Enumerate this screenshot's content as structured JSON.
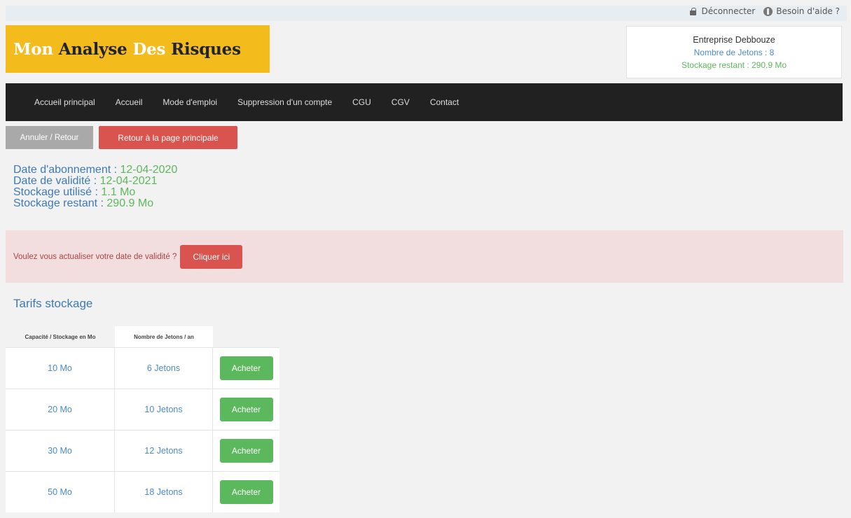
{
  "header": {
    "logout_label": "Déconnecter",
    "help_label": "Besoin d'aide ?",
    "logo_words": [
      "Mon",
      "Analyse",
      "Des",
      "Risques"
    ]
  },
  "account": {
    "company": "Entreprise Debbouze",
    "tokens": "Nombre de Jetons : 8",
    "storage": "Stockage restant : 290.9 Mo"
  },
  "nav": {
    "items": [
      "Accueil principal",
      "Accueil",
      "Mode d'emploi",
      "Suppression d'un compte",
      "CGU",
      "CGV",
      "Contact"
    ]
  },
  "actions": {
    "back_label": "Annuler / Retour",
    "home_label": "Retour à la page principale"
  },
  "subscription": {
    "start_label": "Date d'abonnement : ",
    "start_value": "12-04-2020",
    "validity_label": "Date de validité : ",
    "validity_value": "12-04-2021",
    "used_label": "Stockage utilisé : ",
    "used_value": "1.1 Mo",
    "remaining_label": "Stockage restant : ",
    "remaining_value": "290.9 Mo"
  },
  "alert": {
    "message": "Voulez vous actualiser votre date de validité ?",
    "button_label": "Cliquer ici"
  },
  "pricing": {
    "title": "Tarifs stockage",
    "headers": [
      "Capacité / Stockage en Mo",
      "Nombre de Jetons / an"
    ],
    "rows": [
      {
        "capacity": "10 Mo",
        "tokens": "6 Jetons",
        "action": "Acheter"
      },
      {
        "capacity": "20 Mo",
        "tokens": "10 Jetons",
        "action": "Acheter"
      },
      {
        "capacity": "30 Mo",
        "tokens": "12 Jetons",
        "action": "Acheter"
      },
      {
        "capacity": "50 Mo",
        "tokens": "18 Jetons",
        "action": "Acheter"
      }
    ]
  },
  "colors": {
    "logo_bg": "#f4bb1c",
    "navbar_bg": "#212121",
    "danger": "#d9534f",
    "success": "#5cb85c",
    "primary_text": "#3d7ab5",
    "alert_bg": "#f2dede"
  }
}
